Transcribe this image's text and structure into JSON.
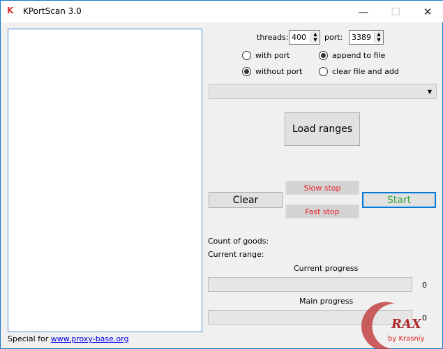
{
  "window": {
    "title": "KPortScan 3.0",
    "minimize": "—",
    "maximize": "☐",
    "close": "✕"
  },
  "settings": {
    "threads_label": "threads:",
    "threads_value": "400",
    "port_label": "port:",
    "port_value": "3389",
    "radios": [
      {
        "label": "with port",
        "checked": false
      },
      {
        "label": "without port",
        "checked": true
      },
      {
        "label": "append to file",
        "checked": true
      },
      {
        "label": "clear file and add",
        "checked": false
      }
    ],
    "dropdown_value": ""
  },
  "buttons": {
    "load_ranges": "Load ranges",
    "clear": "Clear",
    "slow_stop": "Slow stop",
    "fast_stop": "Fast stop",
    "start": "Start"
  },
  "status": {
    "count_of_goods": "Count of goods:",
    "current_range": "Current range:",
    "current_progress_label": "Current progress",
    "current_progress_value": "0",
    "main_progress_label": "Main progress",
    "main_progress_value": "0",
    "current_progress_fraction": 0,
    "main_progress_fraction": 0
  },
  "footer": {
    "special_for": "Special for",
    "link": "www.proxy-base.org"
  },
  "watermark": {
    "text": "RAX",
    "sub": "by Krasniy"
  },
  "colors": {
    "stop": "#e8202a",
    "start": "#3aa53a",
    "accent": "#0078d7"
  }
}
